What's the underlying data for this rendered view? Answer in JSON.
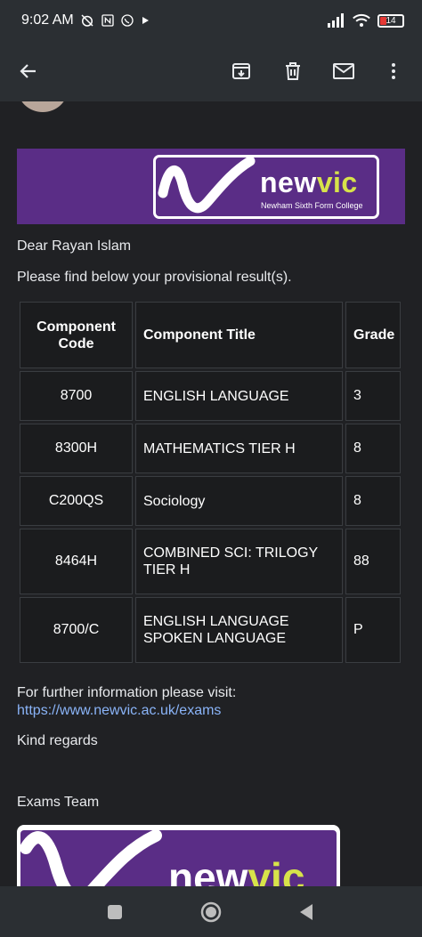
{
  "status": {
    "time": "9:02 AM",
    "battery": "14"
  },
  "toolbar": {
    "back_icon": "arrow-left-icon",
    "archive_icon": "archive-icon",
    "delete_icon": "trash-icon",
    "mail_icon": "mail-icon",
    "more_icon": "more-vertical-icon"
  },
  "banner": {
    "brand_part1": "new",
    "brand_part2": "vic",
    "subtitle": "Newham Sixth Form College"
  },
  "email": {
    "greeting": "Dear Rayan Islam",
    "intro": "Please find below your provisional result(s).",
    "table": {
      "headers": [
        "Component Code",
        "Component Title",
        "Grade"
      ],
      "rows": [
        {
          "code": "8700",
          "title": "ENGLISH LANGUAGE",
          "grade": "3"
        },
        {
          "code": "8300H",
          "title": "MATHEMATICS TIER H",
          "grade": "8"
        },
        {
          "code": "C200QS",
          "title": "Sociology",
          "grade": "8"
        },
        {
          "code": "8464H",
          "title": "COMBINED SCI: TRILOGY TIER H",
          "grade": "88"
        },
        {
          "code": "8700/C",
          "title": "ENGLISH LANGUAGE SPOKEN LANGUAGE",
          "grade": "P"
        }
      ]
    },
    "further_info": "For further information please visit:",
    "link": "https://www.newvic.ac.uk/exams",
    "regards": "Kind regards",
    "signature": "Exams Team"
  },
  "colors": {
    "background": "#202124",
    "bar": "#2b2f33",
    "brand_purple": "#5a2d86",
    "brand_yellow": "#d7e34a",
    "link": "#8ab4f8"
  }
}
